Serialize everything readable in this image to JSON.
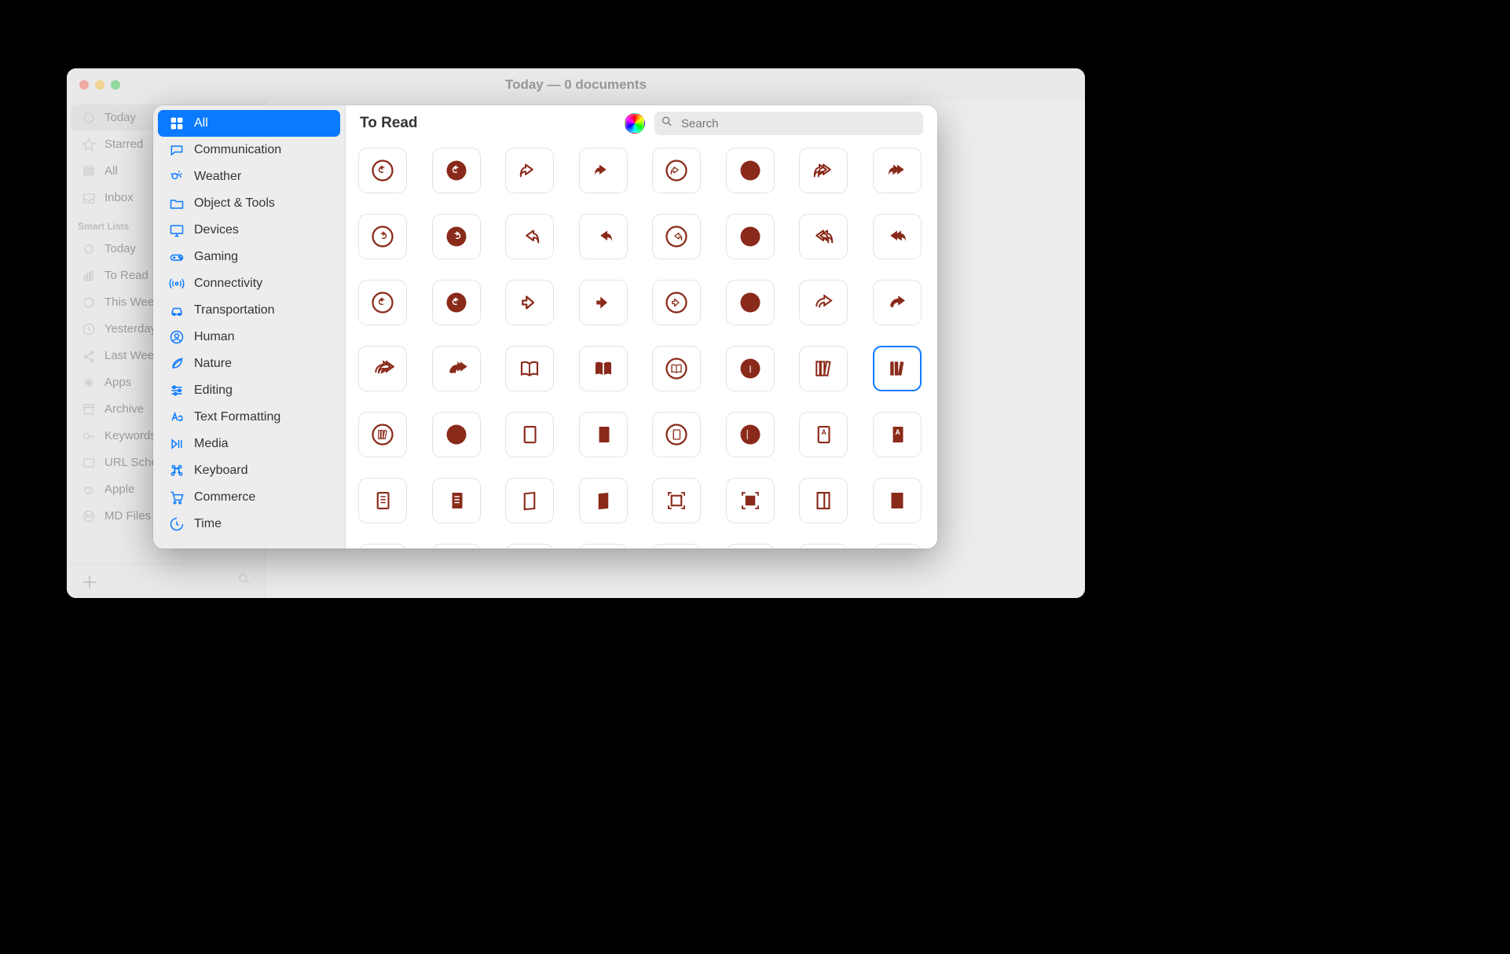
{
  "window": {
    "title": "Today — 0 documents"
  },
  "sidebar": {
    "items": [
      {
        "label": "Today",
        "icon": "today"
      },
      {
        "label": "Starred",
        "icon": "star"
      },
      {
        "label": "All",
        "icon": "stack"
      },
      {
        "label": "Inbox",
        "icon": "tray"
      }
    ],
    "section_label": "Smart Lists",
    "smart": [
      {
        "label": "Today",
        "icon": "dot"
      },
      {
        "label": "To Read",
        "icon": "bars"
      },
      {
        "label": "This Week",
        "icon": "circle"
      },
      {
        "label": "Yesterday",
        "icon": "clock"
      },
      {
        "label": "Last Week",
        "icon": "share"
      },
      {
        "label": "Apps",
        "icon": "asterisk"
      },
      {
        "label": "Archive",
        "icon": "archive"
      },
      {
        "label": "Keywords",
        "icon": "key"
      },
      {
        "label": "URL Scheme",
        "icon": "urlbox"
      },
      {
        "label": "Apple",
        "icon": "apple"
      },
      {
        "label": "MD Files",
        "icon": "m"
      }
    ]
  },
  "popover": {
    "title": "To Read",
    "search_placeholder": "Search",
    "categories": [
      {
        "label": "All",
        "icon": "grid"
      },
      {
        "label": "Communication",
        "icon": "chat"
      },
      {
        "label": "Weather",
        "icon": "weather"
      },
      {
        "label": "Object & Tools",
        "icon": "folder"
      },
      {
        "label": "Devices",
        "icon": "monitor"
      },
      {
        "label": "Gaming",
        "icon": "gamepad"
      },
      {
        "label": "Connectivity",
        "icon": "signal"
      },
      {
        "label": "Transportation",
        "icon": "car"
      },
      {
        "label": "Human",
        "icon": "person"
      },
      {
        "label": "Nature",
        "icon": "leaf"
      },
      {
        "label": "Editing",
        "icon": "sliders"
      },
      {
        "label": "Text Formatting",
        "icon": "textformat"
      },
      {
        "label": "Media",
        "icon": "playpause"
      },
      {
        "label": "Keyboard",
        "icon": "command"
      },
      {
        "label": "Commerce",
        "icon": "cart"
      },
      {
        "label": "Time",
        "icon": "time"
      }
    ],
    "selected_category": 0,
    "icon_color": "#8a2a1a",
    "selected_icon_index": 31,
    "icons": [
      "arrow-uturn-left-circle",
      "arrow-uturn-left-circle-fill",
      "arrowshape-turn-up-right",
      "arrowshape-turn-up-right-fill",
      "arrowshape-turn-up-right-circle",
      "arrowshape-turn-up-right-circle-fill",
      "arrowshape-turn-up-right-2",
      "arrowshape-turn-up-right-2-fill",
      "arrow-uturn-right-circle",
      "arrow-uturn-right-circle-fill",
      "arrowshape-undo",
      "arrowshape-undo-fill",
      "arrowshape-undo-circle",
      "arrowshape-undo-circle-fill",
      "arrowshape-undo-2",
      "arrowshape-undo-2-fill",
      "arrow-uturn-left-circle-b",
      "arrow-uturn-left-circle-b-fill",
      "arrowshape-right",
      "arrowshape-right-fill",
      "arrowshape-right-circle",
      "arrowshape-right-circle-fill",
      "arrowshape-bounce-right",
      "arrowshape-bounce-right-fill",
      "arrowshape-bounce-right-2",
      "arrowshape-bounce-right-2-fill",
      "book",
      "book-fill",
      "book-circle",
      "book-circle-fill",
      "books-vertical",
      "books-vertical-fill",
      "books-vertical-circle",
      "books-vertical-circle-fill",
      "book-closed",
      "book-closed-fill",
      "book-closed-circle",
      "book-closed-circle-fill",
      "character-book-closed",
      "character-book-closed-fill",
      "text-book-closed",
      "text-book-closed-fill",
      "menucard",
      "menucard-fill",
      "camera-viewfinder",
      "camera-viewfinder-fill",
      "magazine",
      "magazine-fill",
      "newspaper",
      "newspaper-fill",
      "newspaper-circle",
      "newspaper-circle-fill",
      "heart-text-square",
      "heart-text-square-fill",
      "square-text-square",
      "square-text-square-fill"
    ]
  }
}
